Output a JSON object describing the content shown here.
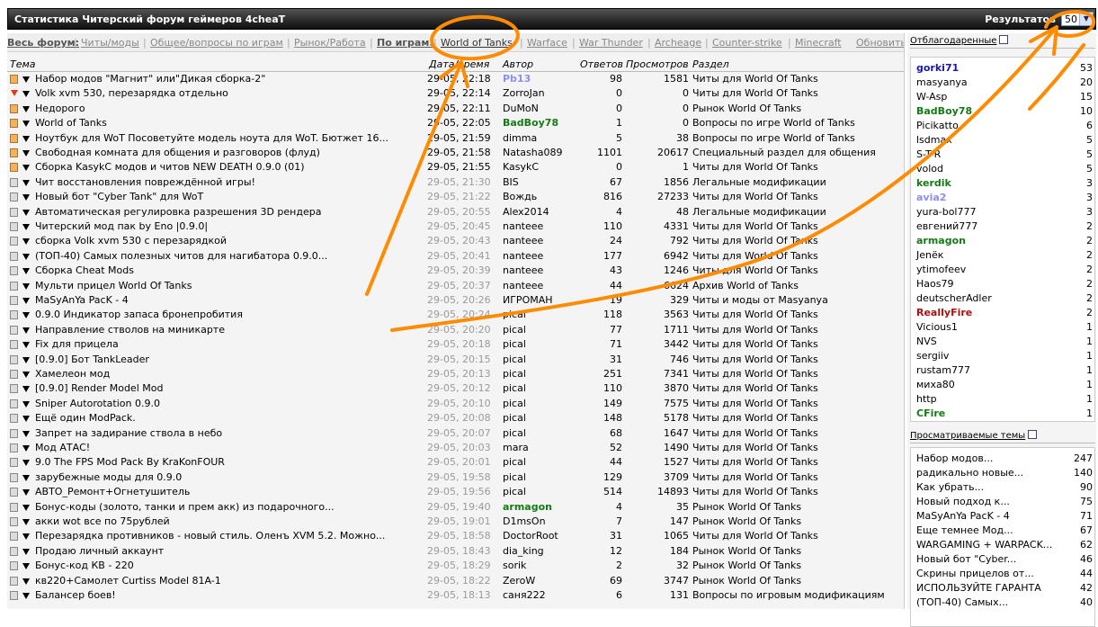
{
  "header": {
    "title": "Статистика Читерский форум геймеров 4cheaT",
    "results_label": "Результатов",
    "results_value": "50"
  },
  "nav": {
    "items": [
      {
        "label": "Весь форум:",
        "kind": "b"
      },
      {
        "label": "Читы/моды",
        "kind": "a"
      },
      {
        "label": "Общее/вопросы по играм",
        "kind": "a"
      },
      {
        "label": "Рынок/Работа",
        "kind": "a"
      },
      {
        "label": "По играм:",
        "kind": "b"
      },
      {
        "label": "World of Tanks",
        "kind": "a"
      },
      {
        "label": "Warface",
        "kind": "a"
      },
      {
        "label": "War Thunder",
        "kind": "a"
      },
      {
        "label": "Archeage",
        "kind": "a"
      },
      {
        "label": "Counter-strike",
        "kind": "a"
      },
      {
        "label": "Minecraft",
        "kind": "a"
      }
    ],
    "refresh": "Обновить"
  },
  "table": {
    "headers": {
      "title": "Тема",
      "date": "Дата/время",
      "author": "Автор",
      "replies": "Ответов",
      "views": "Просмотров",
      "section": "Раздел"
    },
    "rows": [
      {
        "icon": "new",
        "title": "Набор модов \"Магнит\" или\"Дикая сборка-2\"",
        "date": "29-05, 22:18",
        "author": "Pb13",
        "astyle": "blue",
        "replies": "98",
        "views": "1581",
        "section": "Читы для World Of Tanks",
        "dark": true
      },
      {
        "icon": "hot",
        "title": "Volk xvm 530, перезарядка отдельно",
        "date": "29-05, 22:14",
        "author": "ZorroJan",
        "astyle": "",
        "replies": "0",
        "views": "0",
        "section": "Читы для World Of Tanks",
        "dark": true
      },
      {
        "icon": "new",
        "title": "Недорого",
        "date": "29-05, 22:11",
        "author": "DuMoN",
        "astyle": "",
        "replies": "0",
        "views": "0",
        "section": "Рынок World Of Tanks",
        "dark": true
      },
      {
        "icon": "new",
        "title": "World of Tanks",
        "date": "29-05, 22:05",
        "author": "BadBoy78",
        "astyle": "green",
        "replies": "1",
        "views": "0",
        "section": "Вопросы по игре World of Tanks",
        "dark": true
      },
      {
        "icon": "new",
        "title": "Ноутбук для WoT Посоветуйте модель ноута для WoT. Бютжет 16...",
        "date": "29-05, 21:59",
        "author": "dimma",
        "astyle": "",
        "replies": "5",
        "views": "38",
        "section": "Вопросы по игре World of Tanks",
        "dark": true
      },
      {
        "icon": "new",
        "title": "Свободная комната для общения и разговоров (флуд)",
        "date": "29-05, 21:58",
        "author": "Natasha089",
        "astyle": "",
        "replies": "1101",
        "views": "20617",
        "section": "Специальный раздел для общения",
        "dark": true
      },
      {
        "icon": "new",
        "title": "Сборка KasykC модов и читов NEW DEATH 0.9.0 (01)",
        "date": "29-05, 21:55",
        "author": "KasykC",
        "astyle": "",
        "replies": "0",
        "views": "1",
        "section": "Читы для World Of Tanks",
        "dark": true
      },
      {
        "icon": "old",
        "title": "Чит восстановления повреждённой игры!",
        "date": "29-05, 21:30",
        "author": "BIS",
        "astyle": "",
        "replies": "67",
        "views": "1856",
        "section": "Легальные модификации",
        "dark": false
      },
      {
        "icon": "old",
        "title": "Новый бот \"Cyber Tank\" для WoT",
        "date": "29-05, 21:22",
        "author": "Вождь",
        "astyle": "",
        "replies": "816",
        "views": "27233",
        "section": "Читы для World Of Tanks",
        "dark": false
      },
      {
        "icon": "old",
        "title": "Автоматическая регулировка разрешения 3D рендера",
        "date": "29-05, 20:55",
        "author": "Alex2014",
        "astyle": "",
        "replies": "4",
        "views": "48",
        "section": "Легальные модификации",
        "dark": false
      },
      {
        "icon": "old",
        "title": "Читерский мод пак by Eno |0.9.0|",
        "date": "29-05, 20:45",
        "author": "nanteee",
        "astyle": "",
        "replies": "110",
        "views": "4331",
        "section": "Читы для World Of Tanks",
        "dark": false
      },
      {
        "icon": "old",
        "title": "сборка Volk xvm 530 с перезарядкой",
        "date": "29-05, 20:43",
        "author": "nanteee",
        "astyle": "",
        "replies": "24",
        "views": "792",
        "section": "Читы для World Of Tanks",
        "dark": false
      },
      {
        "icon": "old",
        "title": "(ТОП-40) Самых полезных читов для нагибатора 0.9.0...",
        "date": "29-05, 20:41",
        "author": "nanteee",
        "astyle": "",
        "replies": "177",
        "views": "6942",
        "section": "Читы для World Of Tanks",
        "dark": false
      },
      {
        "icon": "old",
        "title": "Сборка Cheat Mods",
        "date": "29-05, 20:39",
        "author": "nanteee",
        "astyle": "",
        "replies": "43",
        "views": "1246",
        "section": "Читы для World Of Tanks",
        "dark": false
      },
      {
        "icon": "old",
        "title": "Мульти прицел World Of Tanks",
        "date": "29-05, 20:37",
        "author": "nanteee",
        "astyle": "",
        "replies": "44",
        "views": "6624",
        "section": "Архив World of Tanks",
        "dark": false
      },
      {
        "icon": "old",
        "title": "MaSyAnYa PacK - 4",
        "date": "29-05, 20:26",
        "author": "ИГРОМАН",
        "astyle": "",
        "replies": "19",
        "views": "329",
        "section": "Читы и моды от Masyanya",
        "dark": false
      },
      {
        "icon": "old",
        "title": "0.9.0 Индикатор запаса бронепробития",
        "date": "29-05, 20:24",
        "author": "pical",
        "astyle": "",
        "replies": "118",
        "views": "3563",
        "section": "Читы для World Of Tanks",
        "dark": false
      },
      {
        "icon": "old",
        "title": "Направление стволов на миникарте",
        "date": "29-05, 20:20",
        "author": "pical",
        "astyle": "",
        "replies": "77",
        "views": "1711",
        "section": "Читы для World Of Tanks",
        "dark": false
      },
      {
        "icon": "old",
        "title": "Fix для прицела",
        "date": "29-05, 20:18",
        "author": "pical",
        "astyle": "",
        "replies": "71",
        "views": "3442",
        "section": "Читы для World Of Tanks",
        "dark": false
      },
      {
        "icon": "old",
        "title": "[0.9.0] Бот TankLeader",
        "date": "29-05, 20:15",
        "author": "pical",
        "astyle": "",
        "replies": "31",
        "views": "746",
        "section": "Читы для World Of Tanks",
        "dark": false
      },
      {
        "icon": "old",
        "title": "Хамелеон мод",
        "date": "29-05, 20:13",
        "author": "pical",
        "astyle": "",
        "replies": "251",
        "views": "7341",
        "section": "Читы для World Of Tanks",
        "dark": false
      },
      {
        "icon": "old",
        "title": "[0.9.0] Render Model Mod",
        "date": "29-05, 20:12",
        "author": "pical",
        "astyle": "",
        "replies": "110",
        "views": "3870",
        "section": "Читы для World Of Tanks",
        "dark": false
      },
      {
        "icon": "old",
        "title": "Sniper Autorotation 0.9.0",
        "date": "29-05, 20:10",
        "author": "pical",
        "astyle": "",
        "replies": "149",
        "views": "7575",
        "section": "Читы для World Of Tanks",
        "dark": false
      },
      {
        "icon": "old",
        "title": "Ещё один ModPack.",
        "date": "29-05, 20:08",
        "author": "pical",
        "astyle": "",
        "replies": "148",
        "views": "5178",
        "section": "Читы для World Of Tanks",
        "dark": false
      },
      {
        "icon": "old",
        "title": "Запрет на задирание ствола в небо",
        "date": "29-05, 20:07",
        "author": "pical",
        "astyle": "",
        "replies": "68",
        "views": "1647",
        "section": "Читы для World Of Tanks",
        "dark": false
      },
      {
        "icon": "old",
        "title": "Мод АТАС!",
        "date": "29-05, 20:03",
        "author": "mara",
        "astyle": "",
        "replies": "52",
        "views": "1490",
        "section": "Читы для World Of Tanks",
        "dark": false
      },
      {
        "icon": "old",
        "title": "9.0 The FPS Mod Pack By KraKonFOUR",
        "date": "29-05, 20:01",
        "author": "pical",
        "astyle": "",
        "replies": "44",
        "views": "1527",
        "section": "Читы для World Of Tanks",
        "dark": false
      },
      {
        "icon": "old",
        "title": "зарубежные моды для 0.9.0",
        "date": "29-05, 19:58",
        "author": "pical",
        "astyle": "",
        "replies": "129",
        "views": "3709",
        "section": "Читы для World Of Tanks",
        "dark": false
      },
      {
        "icon": "old",
        "title": "АВТО_Ремонт+Огнетушитель",
        "date": "29-05, 19:56",
        "author": "pical",
        "astyle": "",
        "replies": "514",
        "views": "14893",
        "section": "Читы для World Of Tanks",
        "dark": false
      },
      {
        "icon": "old",
        "title": "Бонус-коды (золото, танки и прем акк) из подарочного...",
        "date": "29-05, 19:40",
        "author": "armagon",
        "astyle": "green",
        "replies": "4",
        "views": "35",
        "section": "Рынок World Of Tanks",
        "dark": false
      },
      {
        "icon": "old",
        "title": "акки wot все по 75рублей",
        "date": "29-05, 19:01",
        "author": "D1msOn",
        "astyle": "",
        "replies": "7",
        "views": "147",
        "section": "Рынок World Of Tanks",
        "dark": false
      },
      {
        "icon": "old",
        "title": "Перезарядка противников - новый стиль. Оленъ XVM 5.2. Можно...",
        "date": "29-05, 18:58",
        "author": "DoctorRoot",
        "astyle": "",
        "replies": "31",
        "views": "1065",
        "section": "Читы для World Of Tanks",
        "dark": false
      },
      {
        "icon": "old",
        "title": "Продаю личный аккаунт",
        "date": "29-05, 18:43",
        "author": "dia_king",
        "astyle": "",
        "replies": "12",
        "views": "184",
        "section": "Рынок World Of Tanks",
        "dark": false
      },
      {
        "icon": "old",
        "title": "Бонус-код КВ - 220",
        "date": "29-05, 18:29",
        "author": "sorik",
        "astyle": "",
        "replies": "2",
        "views": "32",
        "section": "Рынок World Of Tanks",
        "dark": false
      },
      {
        "icon": "old",
        "title": "кв220+Самолет Curtiss Model 81A-1",
        "date": "29-05, 18:22",
        "author": "ZeroW",
        "astyle": "",
        "replies": "69",
        "views": "3747",
        "section": "Рынок World Of Tanks",
        "dark": false
      },
      {
        "icon": "old",
        "title": "Балансер боев!",
        "date": "29-05, 18:13",
        "author": "саня222",
        "astyle": "",
        "replies": "6",
        "views": "131",
        "section": "Вопросы по игровым модификациям",
        "dark": false
      }
    ]
  },
  "sidebar": {
    "thanked_title": "Отблагодаренные",
    "thanked": [
      {
        "name": "gorki71",
        "count": "53",
        "style": "blue"
      },
      {
        "name": "masyanya",
        "count": "20",
        "style": ""
      },
      {
        "name": "W-Asp",
        "count": "15",
        "style": ""
      },
      {
        "name": "BadBoy78",
        "count": "10",
        "style": "green"
      },
      {
        "name": "Picikatto",
        "count": "6",
        "style": ""
      },
      {
        "name": "lsdmax",
        "count": "5",
        "style": ""
      },
      {
        "name": "S-T-R",
        "count": "5",
        "style": ""
      },
      {
        "name": "volod",
        "count": "5",
        "style": ""
      },
      {
        "name": "kerdik",
        "count": "3",
        "style": "green"
      },
      {
        "name": "avia2",
        "count": "3",
        "style": "lblue"
      },
      {
        "name": "yura-bol777",
        "count": "3",
        "style": ""
      },
      {
        "name": "евгений777",
        "count": "2",
        "style": ""
      },
      {
        "name": "armagon",
        "count": "2",
        "style": "green"
      },
      {
        "name": "Jenёк",
        "count": "2",
        "style": ""
      },
      {
        "name": "ytimofeev",
        "count": "2",
        "style": ""
      },
      {
        "name": "Haos79",
        "count": "2",
        "style": ""
      },
      {
        "name": "deutscherAdler",
        "count": "2",
        "style": ""
      },
      {
        "name": "ReallyFire",
        "count": "2",
        "style": "red"
      },
      {
        "name": "Vicious1",
        "count": "1",
        "style": ""
      },
      {
        "name": "NVS",
        "count": "1",
        "style": ""
      },
      {
        "name": "sergiiv",
        "count": "1",
        "style": ""
      },
      {
        "name": "rustam777",
        "count": "1",
        "style": ""
      },
      {
        "name": "миха80",
        "count": "1",
        "style": ""
      },
      {
        "name": "http",
        "count": "1",
        "style": ""
      },
      {
        "name": "CFire",
        "count": "1",
        "style": "green"
      }
    ],
    "viewed_title": "Просматриваемые темы",
    "viewed": [
      {
        "name": "Набор модов...",
        "count": "247"
      },
      {
        "name": "радикально новые...",
        "count": "140"
      },
      {
        "name": "Как убрать...",
        "count": "90"
      },
      {
        "name": "Новый подход к...",
        "count": "75"
      },
      {
        "name": "MaSyAnYa PacK - 4",
        "count": "71"
      },
      {
        "name": "Еще темнее Мод...",
        "count": "67"
      },
      {
        "name": "WARGAMING + WARPACK...",
        "count": "62"
      },
      {
        "name": "Новый бот \"Cyber...",
        "count": "46"
      },
      {
        "name": "Скрины прицелов от...",
        "count": "44"
      },
      {
        "name": "ИСПОЛЬЗУЙТЕ ГАРАНТА",
        "count": "42"
      },
      {
        "name": "(ТОП-40) Самых...",
        "count": "40"
      }
    ]
  }
}
